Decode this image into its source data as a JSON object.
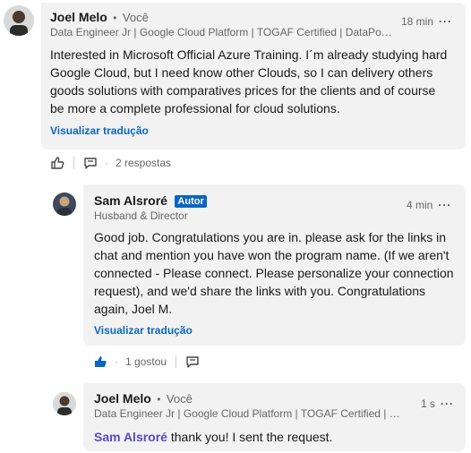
{
  "comments": [
    {
      "author": "Joel Melo",
      "you_label": "Você",
      "headline": "Data Engineer Jr | Google Cloud Platform | TOGAF Certified | DataPower C...",
      "time": "18 min",
      "text_lines": [
        "Interested in Microsoft Official Azure Training. I´m already studying hard",
        "Google Cloud, but I need know other Clouds, so I can delivery others",
        "goods solutions with comparatives prices for the clients and of course",
        "be more a complete professional for cloud solutions."
      ],
      "translate_label": "Visualizar tradução",
      "replies_count": "2 respostas"
    }
  ],
  "reply1": {
    "author": "Sam Alsroré",
    "badge": "Autor",
    "headline": "Husband & Director",
    "time": "4 min",
    "text_lines": [
      "Good job. Congratulations you are in. please ask for the links in",
      "chat and mention you have won the program name. (If we aren't",
      "connected - Please connect. Please personalize your connection",
      "request), and we'd share the links with you. Congratulations",
      "again, Joel M."
    ],
    "translate_label": "Visualizar tradução",
    "likes": "1 gostou"
  },
  "reply2": {
    "author": "Joel Melo",
    "you_label": "Você",
    "headline": "Data Engineer Jr | Google Cloud Platform | TOGAF Certified | Dat...",
    "time": "1 s",
    "mention": "Sam Alsroré",
    "text": " thank you! I sent the request."
  },
  "colors": {
    "link": "#0a66c2",
    "mention": "#5b4ac4",
    "bubble": "#f2f2f2"
  },
  "icons": [
    "like-icon",
    "reply-icon",
    "more-icon",
    "liked-icon"
  ]
}
